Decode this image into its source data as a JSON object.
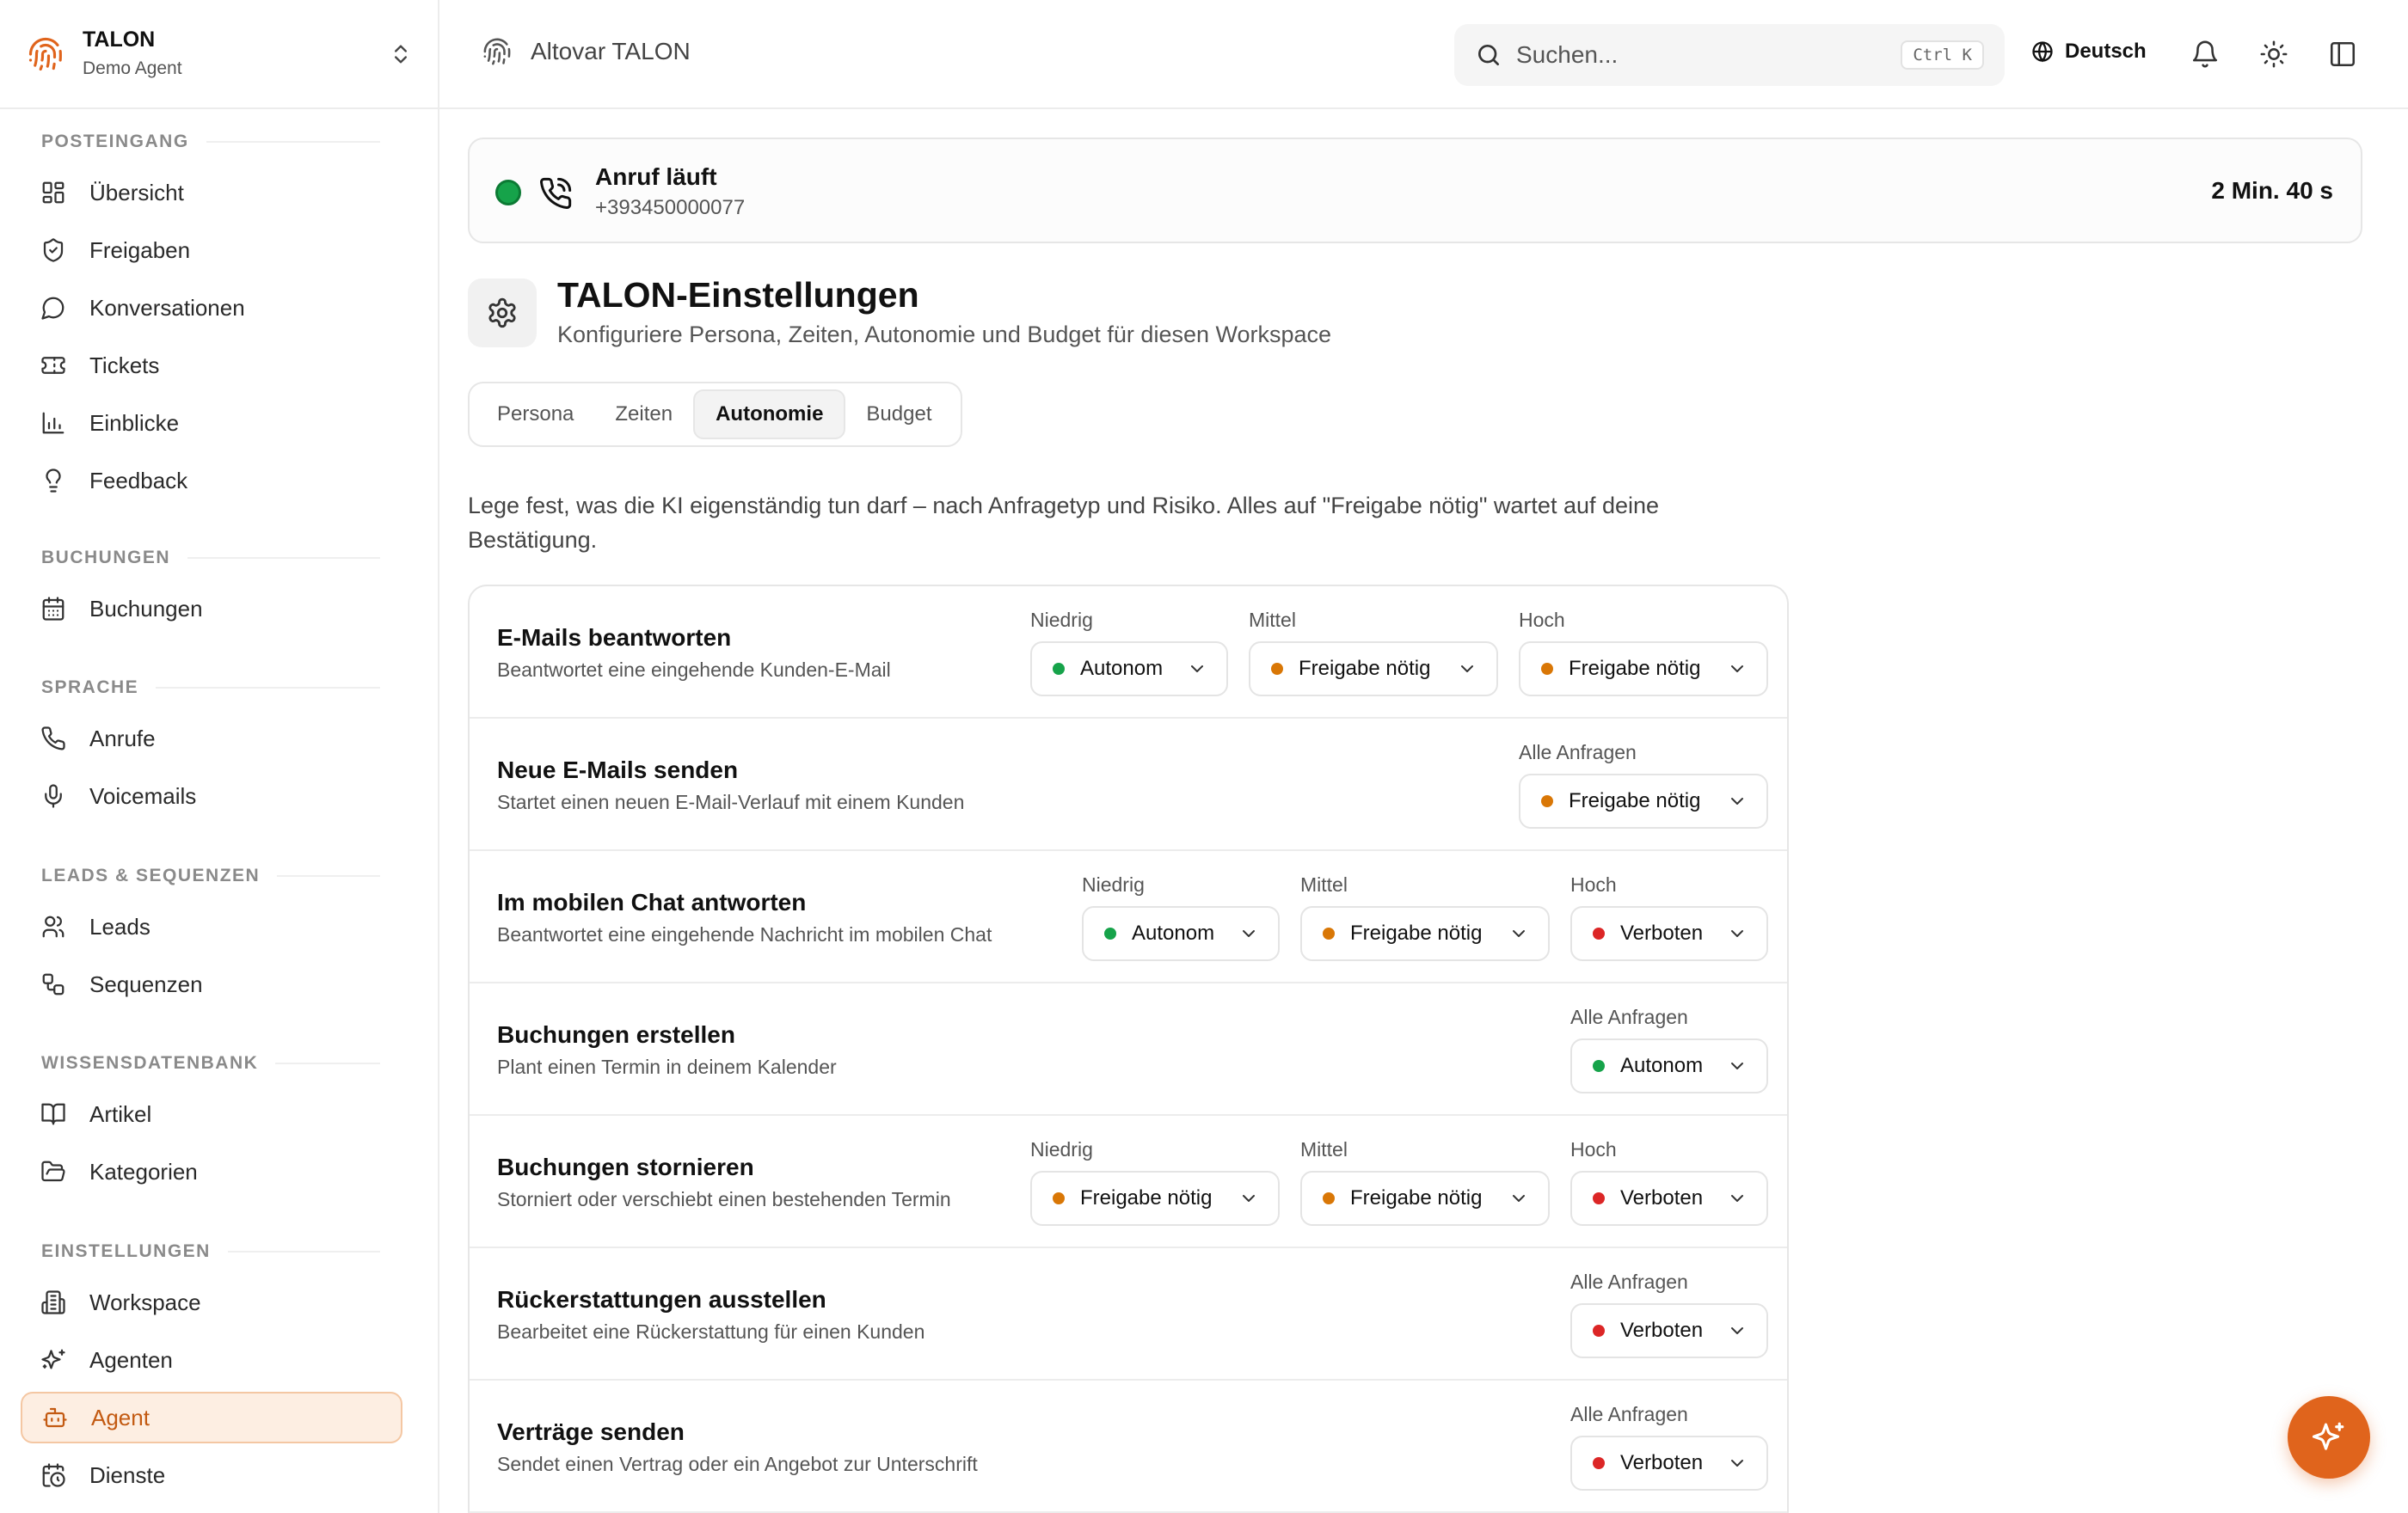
{
  "brand": {
    "name": "TALON",
    "subtitle": "Demo Agent"
  },
  "sidebar": {
    "sections": [
      {
        "title": "POSTEINGANG",
        "items": [
          {
            "label": "Übersicht",
            "icon": "grid-icon"
          },
          {
            "label": "Freigaben",
            "icon": "shield-check-icon"
          },
          {
            "label": "Konversationen",
            "icon": "chat-bubble-icon"
          },
          {
            "label": "Tickets",
            "icon": "ticket-icon"
          },
          {
            "label": "Einblicke",
            "icon": "bar-chart-icon"
          },
          {
            "label": "Feedback",
            "icon": "lightbulb-icon"
          }
        ]
      },
      {
        "title": "BUCHUNGEN",
        "items": [
          {
            "label": "Buchungen",
            "icon": "calendar-icon"
          }
        ]
      },
      {
        "title": "SPRACHE",
        "items": [
          {
            "label": "Anrufe",
            "icon": "phone-icon"
          },
          {
            "label": "Voicemails",
            "icon": "microphone-icon"
          }
        ]
      },
      {
        "title": "LEADS & SEQUENZEN",
        "items": [
          {
            "label": "Leads",
            "icon": "users-icon"
          },
          {
            "label": "Sequenzen",
            "icon": "workflow-icon"
          }
        ]
      },
      {
        "title": "WISSENSDATENBANK",
        "items": [
          {
            "label": "Artikel",
            "icon": "book-icon"
          },
          {
            "label": "Kategorien",
            "icon": "folder-icon"
          }
        ]
      },
      {
        "title": "EINSTELLUNGEN",
        "items": [
          {
            "label": "Workspace",
            "icon": "building-icon"
          },
          {
            "label": "Agenten",
            "icon": "sparkles-icon"
          },
          {
            "label": "Agent",
            "icon": "bot-icon",
            "active": true
          },
          {
            "label": "Dienste",
            "icon": "calendar-clock-icon"
          }
        ]
      }
    ]
  },
  "topbar": {
    "app_title": "Altovar TALON",
    "search_placeholder": "Suchen...",
    "search_shortcut": "Ctrl K",
    "language": "Deutsch"
  },
  "call": {
    "title": "Anruf läuft",
    "number": "+393450000077",
    "duration": "2 Min. 40 s"
  },
  "page": {
    "title": "TALON-Einstellungen",
    "subtitle": "Konfiguriere Persona, Zeiten, Autonomie und Budget für diesen Workspace",
    "tabs": [
      "Persona",
      "Zeiten",
      "Autonomie",
      "Budget"
    ],
    "active_tab": "Autonomie",
    "intro": "Lege fest, was die KI eigenständig tun darf – nach Anfragetyp und Risiko. Alles auf \"Freigabe nötig\" wartet auf deine Bestätigung."
  },
  "levels": {
    "low": "Niedrig",
    "mid": "Mittel",
    "high": "Hoch",
    "all": "Alle Anfragen"
  },
  "status_colors": {
    "Autonom": "#16a34a",
    "Freigabe nötig": "#d97706",
    "Verboten": "#dc2626"
  },
  "rows": [
    {
      "title": "E-Mails beantworten",
      "desc": "Beantwortet eine eingehende Kunden-E-Mail",
      "low": "Autonom",
      "mid": "Freigabe nötig",
      "high": "Freigabe nötig"
    },
    {
      "title": "Neue E-Mails senden",
      "desc": "Startet einen neuen E-Mail-Verlauf mit einem Kunden",
      "all": "Freigabe nötig"
    },
    {
      "title": "Im mobilen Chat antworten",
      "desc": "Beantwortet eine eingehende Nachricht im mobilen Chat",
      "low": "Autonom",
      "mid": "Freigabe nötig",
      "high": "Verboten"
    },
    {
      "title": "Buchungen erstellen",
      "desc": "Plant einen Termin in deinem Kalender",
      "all": "Autonom"
    },
    {
      "title": "Buchungen stornieren",
      "desc": "Storniert oder verschiebt einen bestehenden Termin",
      "low": "Freigabe nötig",
      "mid": "Freigabe nötig",
      "high": "Verboten"
    },
    {
      "title": "Rückerstattungen ausstellen",
      "desc": "Bearbeitet eine Rückerstattung für einen Kunden",
      "all": "Verboten"
    },
    {
      "title": "Verträge senden",
      "desc": "Sendet einen Vertrag oder ein Angebot zur Unterschrift",
      "all": "Verboten"
    }
  ]
}
